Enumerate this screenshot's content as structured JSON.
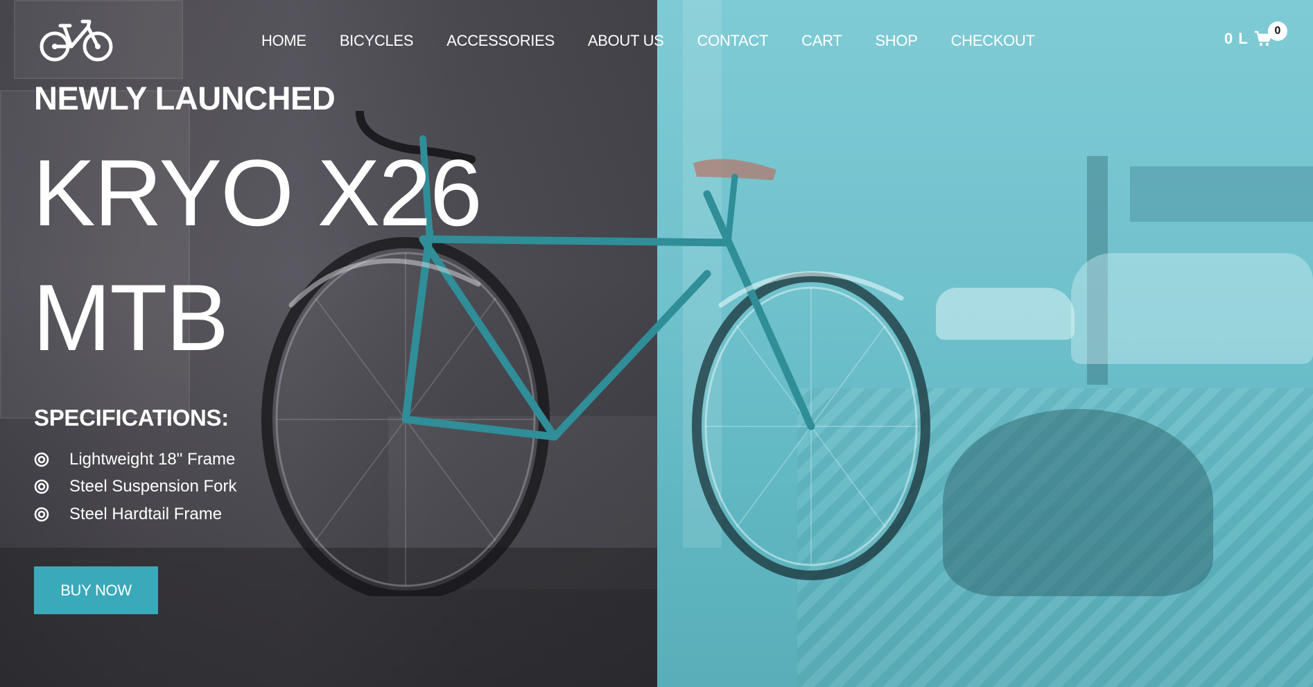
{
  "brand": {
    "logo_icon": "bicycle-icon"
  },
  "nav": {
    "items": [
      {
        "label": "HOME"
      },
      {
        "label": "BICYCLES"
      },
      {
        "label": "ACCESSORIES"
      },
      {
        "label": "ABOUT US"
      },
      {
        "label": "CONTACT"
      },
      {
        "label": "CART"
      },
      {
        "label": "SHOP"
      },
      {
        "label": "CHECKOUT"
      }
    ]
  },
  "cart": {
    "total": "0 L",
    "count": "0",
    "icon": "shopping-cart-icon"
  },
  "hero": {
    "eyebrow": "NEWLY LAUNCHED",
    "title_line1": "KRYO X26",
    "title_line2": "MTB",
    "specs_heading": "SPECIFICATIONS:",
    "specs": [
      {
        "label": "Lightweight 18\" Frame",
        "icon": "target-circle-icon"
      },
      {
        "label": "Steel Suspension Fork",
        "icon": "target-circle-icon"
      },
      {
        "label": "Steel Hardtail Frame",
        "icon": "target-circle-icon"
      }
    ],
    "cta_label": "BUY NOW"
  },
  "colors": {
    "accent": "#3aa9ba",
    "overlay_teal": "#6fc1cc",
    "overlay_dark": "#4a4850",
    "text": "#ffffff"
  }
}
